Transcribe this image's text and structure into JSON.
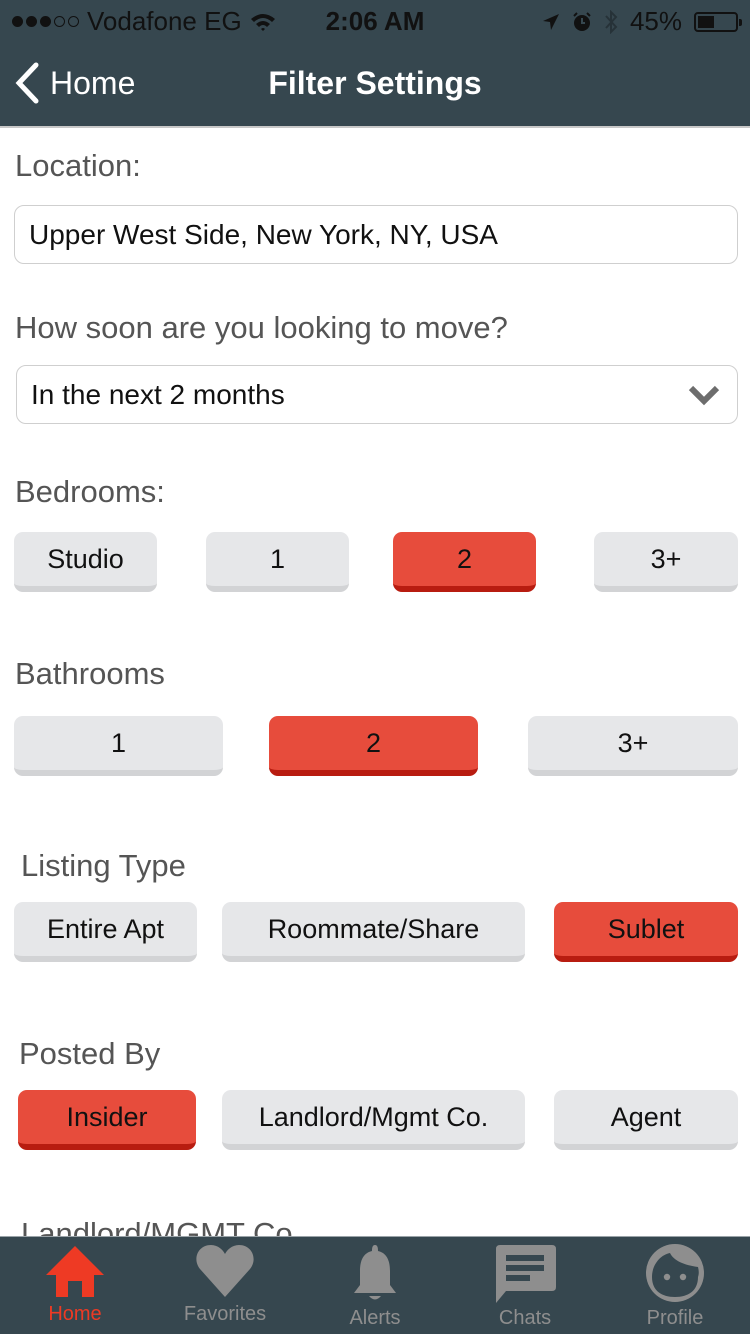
{
  "status_bar": {
    "signal_bars_filled": 3,
    "signal_bars_total": 5,
    "carrier": "Vodafone EG",
    "time": "2:06 AM",
    "battery_percent_label": "45%",
    "battery_level": 0.45
  },
  "nav": {
    "back_label": "Home",
    "title": "Filter Settings"
  },
  "location": {
    "label": "Location:",
    "value": "Upper West Side, New York, NY, USA"
  },
  "move_timing": {
    "label": "How soon are you looking to move?",
    "selected": "In the next 2 months"
  },
  "bedrooms": {
    "label": "Bedrooms:",
    "options": [
      "Studio",
      "1",
      "2",
      "3+"
    ],
    "selected_index": 2
  },
  "bathrooms": {
    "label": "Bathrooms",
    "options": [
      "1",
      "2",
      "3+"
    ],
    "selected_index": 1
  },
  "listing_type": {
    "label": "Listing Type",
    "options": [
      "Entire Apt",
      "Roommate/Share",
      "Sublet"
    ],
    "selected_index": 2
  },
  "posted_by": {
    "label": "Posted By",
    "options": [
      "Insider",
      "Landlord/Mgmt Co.",
      "Agent"
    ],
    "selected_index": 0
  },
  "next_section": {
    "label": "Landlord/MGMT Co."
  },
  "tabbar": {
    "items": [
      {
        "label": "Home",
        "icon": "home-icon",
        "active": true
      },
      {
        "label": "Favorites",
        "icon": "heart-icon",
        "active": false
      },
      {
        "label": "Alerts",
        "icon": "bell-icon",
        "active": false
      },
      {
        "label": "Chats",
        "icon": "chat-icon",
        "active": false
      },
      {
        "label": "Profile",
        "icon": "profile-icon",
        "active": false
      }
    ]
  },
  "colors": {
    "bar_background": "#36474f",
    "accent": "#e74c3c",
    "accent_shadow": "#b81c10",
    "tab_active": "#ee3a24",
    "tab_inactive": "#8e8e8e",
    "option_background": "#e6e7e9"
  }
}
